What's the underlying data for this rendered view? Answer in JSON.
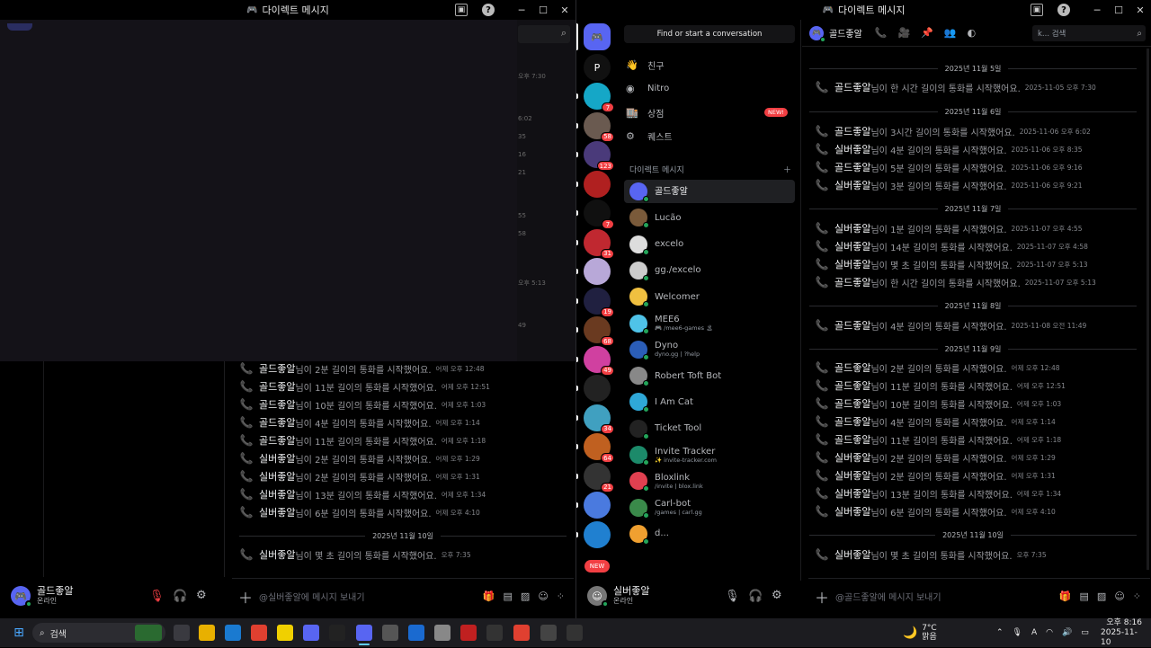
{
  "left_window": {
    "title": "다이렉트 메시지",
    "dim_timestamps": [
      "오후 7:30",
      "6:02",
      "35",
      "16",
      "21",
      "55",
      "58",
      "오후 5:13",
      "49"
    ],
    "messages": [
      {
        "name": "골드좋알",
        "text": "님이 2분 길이의 통화를 시작했어요.",
        "time": "어제 오후 12:48"
      },
      {
        "name": "골드좋알",
        "text": "님이 11분 길이의 통화를 시작했어요.",
        "time": "어제 오후 12:51"
      },
      {
        "name": "골드좋알",
        "text": "님이 10분 길이의 통화를 시작했어요.",
        "time": "어제 오후 1:03"
      },
      {
        "name": "골드좋알",
        "text": "님이 4분 길이의 통화를 시작했어요.",
        "time": "어제 오후 1:14"
      },
      {
        "name": "골드좋알",
        "text": "님이 11분 길이의 통화를 시작했어요.",
        "time": "어제 오후 1:18"
      },
      {
        "name": "실버좋알",
        "text": "님이 2분 길이의 통화를 시작했어요.",
        "time": "어제 오후 1:29"
      },
      {
        "name": "실버좋알",
        "text": "님이 2분 길이의 통화를 시작했어요.",
        "time": "어제 오후 1:31"
      },
      {
        "name": "실버좋알",
        "text": "님이 13분 길이의 통화를 시작했어요.",
        "time": "어제 오후 1:34"
      },
      {
        "name": "실버좋알",
        "text": "님이 6분 길이의 통화를 시작했어요.",
        "time": "어제 오후 4:10"
      }
    ],
    "date_sep": "2025년 11월 10일",
    "last_message": {
      "name": "실버좋알",
      "text": "님이 몇 초 길이의 통화를 시작했어요.",
      "time": "오후 7:35"
    },
    "user": {
      "name": "골드좋알",
      "status": "온라인"
    },
    "composer_placeholder": "@실버좋알에 메시지 보내기"
  },
  "right_window": {
    "title": "다이렉트 메시지",
    "find_bar": "Find or start a conversation",
    "nav": [
      {
        "icon": "friends-icon",
        "label": "친구"
      },
      {
        "icon": "nitro-icon",
        "label": "Nitro"
      },
      {
        "icon": "shop-icon",
        "label": "상점",
        "badge": "NEW!"
      },
      {
        "icon": "quests-icon",
        "label": "퀘스트"
      }
    ],
    "dm_header": "다이렉트 메시지",
    "dms": [
      {
        "name": "골드좋알",
        "sub": "",
        "color": "#5865f2",
        "selected": true
      },
      {
        "name": "Lucão",
        "sub": "",
        "color": "#7a5a3a"
      },
      {
        "name": "excelo",
        "sub": "",
        "color": "#dddddd"
      },
      {
        "name": "gg./excelo",
        "sub": "",
        "color": "#cccccc"
      },
      {
        "name": "Welcomer",
        "sub": "",
        "color": "#f0c040"
      },
      {
        "name": "MEE6",
        "sub": "🎮 /mee6-games 🏝",
        "color": "#4fc3e8"
      },
      {
        "name": "Dyno",
        "sub": "dyno.gg | ?help",
        "color": "#2b5eb8"
      },
      {
        "name": "Robert Toft Bot",
        "sub": "",
        "color": "#888888"
      },
      {
        "name": "I Am Cat",
        "sub": "",
        "color": "#2fa8d8"
      },
      {
        "name": "Ticket Tool",
        "sub": "",
        "color": "#222222"
      },
      {
        "name": "Invite Tracker",
        "sub": "✨ invite-tracker.com",
        "color": "#1c8a6a"
      },
      {
        "name": "Bloxlink",
        "sub": "/invite | blox.link",
        "color": "#e04050"
      },
      {
        "name": "Carl-bot",
        "sub": "/games | carl.gg",
        "color": "#3a8a4a"
      },
      {
        "name": "d...",
        "sub": "",
        "color": "#f0a030"
      }
    ],
    "servers": [
      {
        "color": "#15a7c7",
        "badge": "7"
      },
      {
        "color": "#6a5a50",
        "badge": "58"
      },
      {
        "color": "#4a3a7a",
        "badge": "123"
      },
      {
        "color": "#b02020",
        "badge": ""
      },
      {
        "color": "#101010",
        "badge": "7"
      },
      {
        "color": "#c02830",
        "badge": "31"
      },
      {
        "color": "#b8a8d8",
        "badge": ""
      },
      {
        "color": "#202040",
        "badge": "19"
      },
      {
        "color": "#6a3a20",
        "badge": "68"
      },
      {
        "color": "#d040a0",
        "badge": "49"
      },
      {
        "color": "#222222",
        "badge": ""
      },
      {
        "color": "#40a0c0",
        "badge": "34"
      },
      {
        "color": "#c06020",
        "badge": "64"
      },
      {
        "color": "#333333",
        "badge": "21"
      },
      {
        "color": "#4a7adf",
        "badge": ""
      },
      {
        "color": "#2080d0",
        "badge": ""
      }
    ],
    "new_tag": "NEW",
    "chat_title": "골드좋알",
    "search_placeholder": "k... 검색",
    "feed": [
      {
        "sep": "2025년 11월 5일"
      },
      {
        "name": "골드좋알",
        "text": "님이 한 시간 길이의 통화를 시작했어요.",
        "time": "2025-11-05 오후 7:30"
      },
      {
        "sep": "2025년 11월 6일"
      },
      {
        "name": "골드좋알",
        "text": "님이 3시간 길이의 통화를 시작했어요.",
        "time": "2025-11-06 오후 6:02"
      },
      {
        "name": "실버좋알",
        "text": "님이 4분 길이의 통화를 시작했어요.",
        "time": "2025-11-06 오후 8:35"
      },
      {
        "name": "골드좋알",
        "text": "님이 5분 길이의 통화를 시작했어요.",
        "time": "2025-11-06 오후 9:16"
      },
      {
        "name": "실버좋알",
        "text": "님이 3분 길이의 통화를 시작했어요.",
        "time": "2025-11-06 오후 9:21"
      },
      {
        "sep": "2025년 11월 7일"
      },
      {
        "name": "실버좋알",
        "text": "님이 1분 길이의 통화를 시작했어요.",
        "time": "2025-11-07 오후 4:55"
      },
      {
        "name": "실버좋알",
        "text": "님이 14분 길이의 통화를 시작했어요.",
        "time": "2025-11-07 오후 4:58"
      },
      {
        "name": "실버좋알",
        "text": "님이 몇 초 길이의 통화를 시작했어요.",
        "time": "2025-11-07 오후 5:13"
      },
      {
        "name": "골드좋알",
        "text": "님이 한 시간 길이의 통화를 시작했어요.",
        "time": "2025-11-07 오후 5:13"
      },
      {
        "sep": "2025년 11월 8일"
      },
      {
        "name": "골드좋알",
        "text": "님이 4분 길이의 통화를 시작했어요.",
        "time": "2025-11-08 오전 11:49"
      },
      {
        "sep": "2025년 11월 9일"
      },
      {
        "name": "골드좋알",
        "text": "님이 2분 길이의 통화를 시작했어요.",
        "time": "어제 오후 12:48"
      },
      {
        "name": "골드좋알",
        "text": "님이 11분 길이의 통화를 시작했어요.",
        "time": "어제 오후 12:51"
      },
      {
        "name": "골드좋알",
        "text": "님이 10분 길이의 통화를 시작했어요.",
        "time": "어제 오후 1:03"
      },
      {
        "name": "골드좋알",
        "text": "님이 4분 길이의 통화를 시작했어요.",
        "time": "어제 오후 1:14"
      },
      {
        "name": "골드좋알",
        "text": "님이 11분 길이의 통화를 시작했어요.",
        "time": "어제 오후 1:18"
      },
      {
        "name": "실버좋알",
        "text": "님이 2분 길이의 통화를 시작했어요.",
        "time": "어제 오후 1:29"
      },
      {
        "name": "실버좋알",
        "text": "님이 2분 길이의 통화를 시작했어요.",
        "time": "어제 오후 1:31"
      },
      {
        "name": "실버좋알",
        "text": "님이 13분 길이의 통화를 시작했어요.",
        "time": "어제 오후 1:34"
      },
      {
        "name": "실버좋알",
        "text": "님이 6분 길이의 통화를 시작했어요.",
        "time": "어제 오후 4:10"
      },
      {
        "sep": "2025년 11월 10일"
      },
      {
        "name": "실버좋알",
        "text": "님이 몇 초 길이의 통화를 시작했어요.",
        "time": "오후 7:35"
      }
    ],
    "user": {
      "name": "실버좋알",
      "status": "온라인"
    },
    "composer_placeholder": "@골드좋알에 메시지 보내기"
  },
  "taskbar": {
    "search": "검색",
    "weather_temp": "7°C",
    "weather_desc": "맑음",
    "time": "오후 8:16",
    "date": "2025-11-10"
  },
  "colors": {
    "accent": "#5865f2",
    "online": "#23a55a",
    "call": "#3ba55d",
    "badge": "#f23f43"
  }
}
